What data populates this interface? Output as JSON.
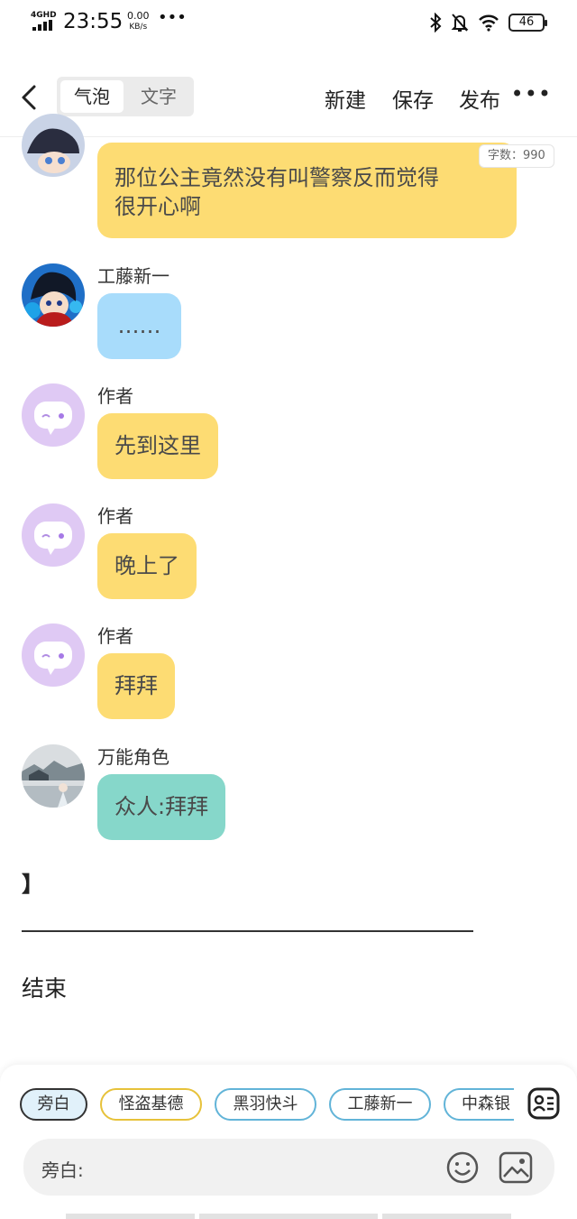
{
  "status_bar": {
    "network": "4GHD",
    "time": "23:55",
    "speed_value": "0.00",
    "speed_unit": "KB/s",
    "dots": "•••",
    "battery": "46",
    "icons": [
      "signal-icon",
      "bluetooth-icon",
      "bell-off-icon",
      "wifi-icon",
      "battery-icon"
    ]
  },
  "header": {
    "tab_bubble": "气泡",
    "tab_text": "文字",
    "new_label": "新建",
    "save_label": "保存",
    "publish_label": "发布",
    "more_label": "•••"
  },
  "word_count": "字数：990",
  "messages": [
    {
      "speaker": "",
      "text_line1": "那位公主竟然没有叫警察反而觉得",
      "text_line2": "很开心啊",
      "color": "yellow"
    },
    {
      "speaker": "工藤新一",
      "text": "……",
      "color": "blue"
    },
    {
      "speaker": "作者",
      "text": "先到这里",
      "color": "yellow"
    },
    {
      "speaker": "作者",
      "text": "晚上了",
      "color": "yellow"
    },
    {
      "speaker": "作者",
      "text": "拜拜",
      "color": "yellow"
    },
    {
      "speaker": "万能角色",
      "text": "众人:拜拜",
      "color": "teal"
    }
  ],
  "after_chat": {
    "bracket": "】",
    "end_text": "结束"
  },
  "role_chips": [
    "旁白",
    "怪盗基德",
    "黑羽快斗",
    "工藤新一",
    "中森银"
  ],
  "input": {
    "label": "旁白:"
  },
  "colors": {
    "yellow_bubble": "#fddc73",
    "blue_bubble": "#a8dcfb",
    "teal_bubble": "#86d7ca",
    "author_avatar": "#dfc9f4",
    "chip_border": "#62b4d8",
    "chip_gold": "#e7c23a"
  }
}
